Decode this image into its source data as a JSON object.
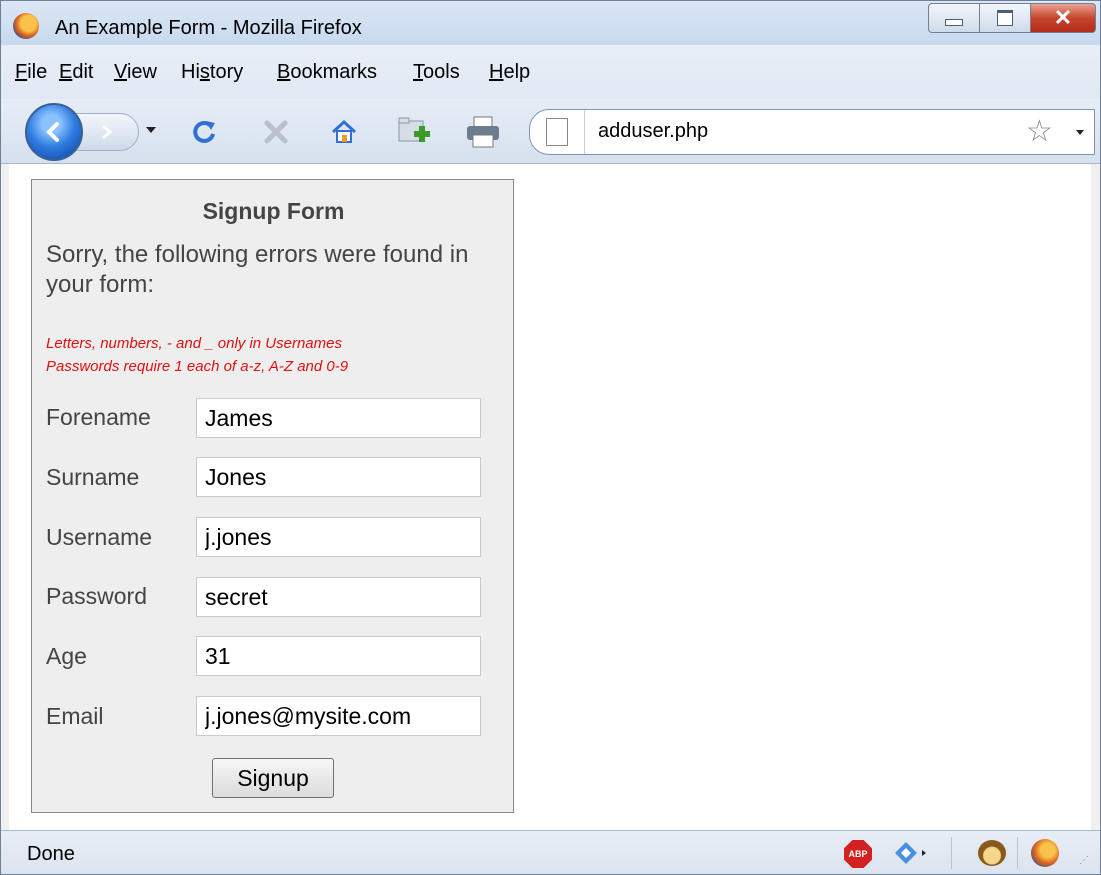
{
  "window": {
    "title": "An Example Form - Mozilla Firefox"
  },
  "menu": {
    "items": [
      {
        "key": "F",
        "rest": "ile"
      },
      {
        "key": "E",
        "rest": "dit"
      },
      {
        "key": "V",
        "rest": "iew"
      },
      {
        "pre": "Hi",
        "key": "s",
        "rest": "tory"
      },
      {
        "key": "B",
        "rest": "ookmarks"
      },
      {
        "key": "T",
        "rest": "ools"
      },
      {
        "key": "H",
        "rest": "elp"
      }
    ]
  },
  "navbar": {
    "url": "adduser.php"
  },
  "form": {
    "title": "Signup Form",
    "error_intro": "Sorry, the following errors were found in your form:",
    "errors": [
      "Letters, numbers, - and _ only in Usernames",
      "Passwords require 1 each of a-z, A-Z and 0-9"
    ],
    "fields": [
      {
        "label": "Forename",
        "value": "James"
      },
      {
        "label": "Surname",
        "value": "Jones"
      },
      {
        "label": "Username",
        "value": "j.jones"
      },
      {
        "label": "Password",
        "value": "secret"
      },
      {
        "label": "Age",
        "value": "31"
      },
      {
        "label": "Email",
        "value": "j.jones@mysite.com"
      }
    ],
    "submit_label": "Signup"
  },
  "status": {
    "text": "Done",
    "adblock_label": "ABP"
  },
  "icons": {
    "back": "back-arrow-icon",
    "forward": "forward-arrow-icon",
    "reload": "reload-icon",
    "stop": "stop-icon",
    "home": "home-icon",
    "new_folder": "new-folder-icon",
    "print": "printer-icon",
    "bookmark_star": "star-icon"
  }
}
